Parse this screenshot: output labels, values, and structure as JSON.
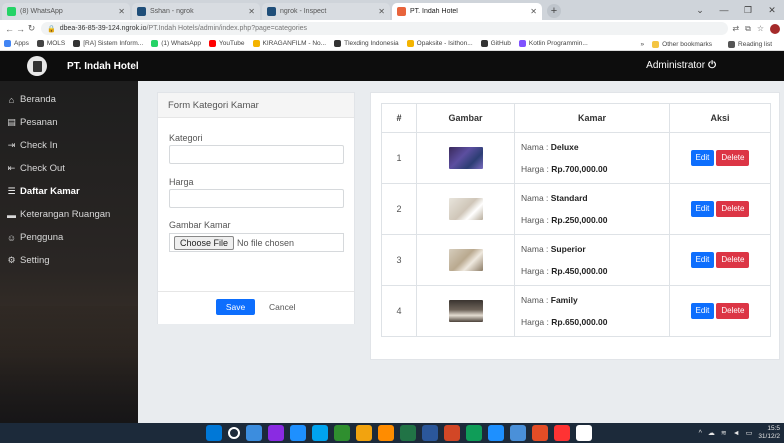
{
  "browser": {
    "tabs": [
      {
        "label": "(8) WhatsApp",
        "color": "#25d366"
      },
      {
        "label": "Sshan - ngrok",
        "color": "#1f4e79"
      },
      {
        "label": "ngrok - Inspect",
        "color": "#1f4e79"
      },
      {
        "label": "PT. Indah Hotel",
        "color": "#e8643c"
      }
    ],
    "url_host": "dbea-36-85-39-124.ngrok.io",
    "url_path": "/PT.Indah Hotels/admin/index.php?page=categories",
    "bookmarks": [
      {
        "label": "Apps",
        "color": "#4285f4"
      },
      {
        "label": "MOLS",
        "color": "#444444"
      },
      {
        "label": "[RA] Sistem Inform...",
        "color": "#333333"
      },
      {
        "label": "(1) WhatsApp",
        "color": "#25d366"
      },
      {
        "label": "YouTube",
        "color": "#ff0000"
      },
      {
        "label": "KIRAGANFILM - No...",
        "color": "#f4b400"
      },
      {
        "label": "Tlexding Indonesia",
        "color": "#333333"
      },
      {
        "label": "Opaksite - Isithon...",
        "color": "#f4b400"
      },
      {
        "label": "GitHub",
        "color": "#333333"
      },
      {
        "label": "Kotlin Programmin...",
        "color": "#7f52ff"
      }
    ],
    "other_bookmarks": "Other bookmarks",
    "reading_list": "Reading list"
  },
  "navbar": {
    "brand": "PT. Indah Hotel",
    "user": "Administrator",
    "power_icon": "⏻"
  },
  "sidebar": {
    "items": [
      {
        "icon": "⌂",
        "label": "Beranda",
        "active": false
      },
      {
        "icon": "▤",
        "label": "Pesanan",
        "active": false
      },
      {
        "icon": "⇥",
        "label": "Check In",
        "active": false
      },
      {
        "icon": "⇤",
        "label": "Check Out",
        "active": false
      },
      {
        "icon": "☰",
        "label": "Daftar Kamar",
        "active": true
      },
      {
        "icon": "▬",
        "label": "Keterangan Ruangan",
        "active": false
      },
      {
        "icon": "☺",
        "label": "Pengguna",
        "active": false
      },
      {
        "icon": "⚙",
        "label": "Setting",
        "active": false
      }
    ]
  },
  "form": {
    "title": "Form Kategori Kamar",
    "kategori_label": "Kategori",
    "kategori_value": "",
    "harga_label": "Harga",
    "harga_value": "",
    "gambar_label": "Gambar Kamar",
    "file_button": "Choose File",
    "file_status": "No file chosen",
    "save_label": "Save",
    "cancel_label": "Cancel"
  },
  "table": {
    "headers": [
      "#",
      "Gambar",
      "Kamar",
      "Aksi"
    ],
    "nama_prefix": "Nama : ",
    "harga_prefix": "Harga : ",
    "edit_label": "Edit",
    "delete_label": "Delete",
    "rows": [
      {
        "no": "1",
        "nama": "Deluxe",
        "harga": "Rp.700,000.00",
        "thumb": "linear-gradient(135deg,#3a2a5c,#5c4fa0 40%,#2c3e74 70%,#7a6cc0)"
      },
      {
        "no": "2",
        "nama": "Standard",
        "harga": "Rp.250,000.00",
        "thumb": "linear-gradient(135deg,#e8e4dc,#cfc6b8 50%,#ffffff 70%,#b8ad9c)"
      },
      {
        "no": "3",
        "nama": "Superior",
        "harga": "Rp.450,000.00",
        "thumb": "linear-gradient(135deg,#d6cdbd,#b9a98f 45%,#efe9df 65%,#8c7c66)"
      },
      {
        "no": "4",
        "nama": "Family",
        "harga": "Rp.650,000.00",
        "thumb": "linear-gradient(180deg,#3a3430,#6e645a 45%,#e4ddd2 70%,#4a4038)"
      }
    ]
  },
  "taskbar": {
    "icons": [
      "#0078d7",
      "#ffffff",
      "#3c8dde",
      "#8a2be2",
      "#1e90ff",
      "#00a4ef",
      "#2f8f2f",
      "#f2a30f",
      "#ff8c00",
      "#217346",
      "#2b579a",
      "#d24726",
      "#0f9d58",
      "#1e90ff",
      "#4a90d9",
      "#e44d26",
      "#ff3333",
      "#ffffff"
    ],
    "time": "15:5",
    "date": "31/12/2"
  }
}
